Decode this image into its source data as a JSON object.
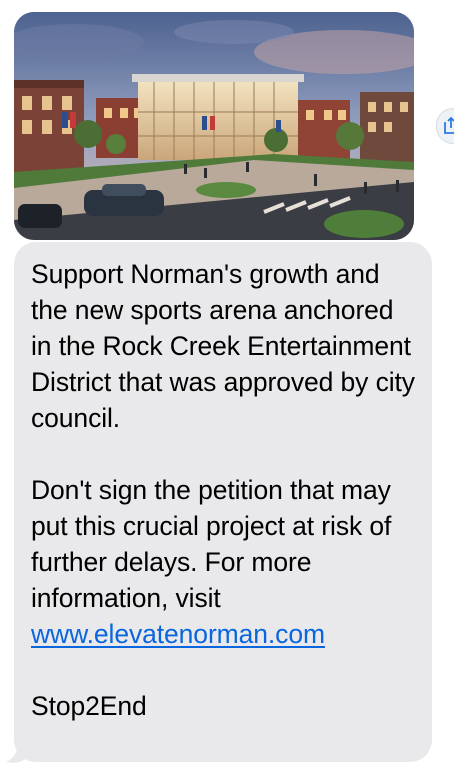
{
  "message": {
    "image": {
      "description_icon": "photo-attachment",
      "colors": {
        "sky_top": "#5b6f98",
        "sky_bottom": "#e7b9a0",
        "street": "#3a3d44",
        "plaza": "#b8a99a",
        "lawn": "#4f7a3a"
      }
    },
    "paragraph_1": "Support Norman's growth and the new sports arena anchored in the Rock Creek Entertainment District that was approved by city council.",
    "paragraph_2_text": "Don't sign the petition that may put this crucial project at risk of further delays. For more information, visit",
    "link_text": "www.elevatenorman.com",
    "signoff": "Stop2End"
  },
  "share_button": {
    "icon": "share-icon"
  },
  "colors": {
    "bubble_bg": "#e9e9eb",
    "text": "#000000",
    "link": "#0a66dc"
  }
}
